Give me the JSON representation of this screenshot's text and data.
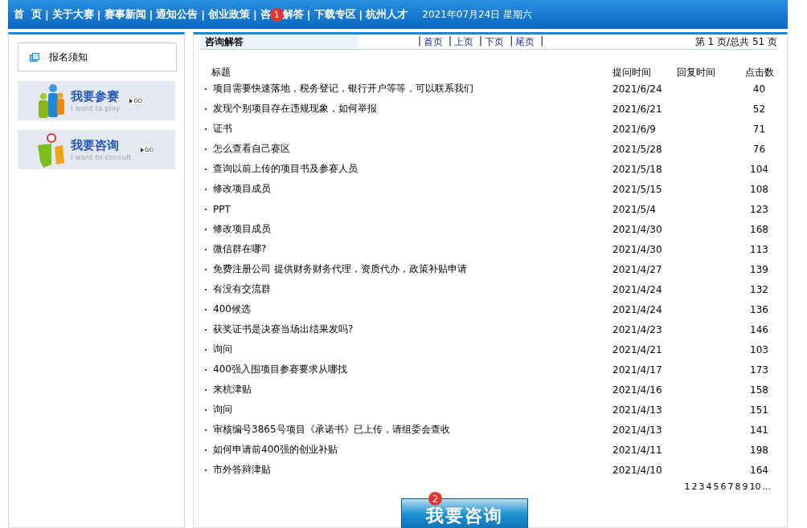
{
  "nav": {
    "separator": "|",
    "items": [
      {
        "label": "首  页"
      },
      {
        "label": "关于大赛"
      },
      {
        "label": "赛事新闻"
      },
      {
        "label": "通知公告"
      },
      {
        "label": "创业政策"
      },
      {
        "label": "咨",
        "label_after": "解答",
        "badge": "1"
      },
      {
        "label": "下载专区"
      },
      {
        "label": "杭州人才"
      }
    ],
    "date": "2021年07月24日 星期六"
  },
  "sidebar": {
    "notice": "报名须知",
    "banners": [
      {
        "kind": "play",
        "title": "我要参赛",
        "subtitle": "I want to play",
        "go": "GO"
      },
      {
        "kind": "consult",
        "title": "我要咨询",
        "subtitle": "I want to consult",
        "go": "GO"
      }
    ]
  },
  "panel": {
    "title": "咨询解答",
    "separator": "|",
    "pager_links": [
      "首页",
      "上页",
      "下页",
      "尾页"
    ],
    "page_info": "第 1 页/总共 51 页"
  },
  "table": {
    "columns": [
      "标题",
      "提问时间",
      "回复时间",
      "点击数"
    ],
    "rows": [
      {
        "title": "项目需要快速落地，税务登记，银行开户等等，可以联系我们",
        "asked": "2021/6/24",
        "clicks": "40"
      },
      {
        "title": "发现个别项目存在违规现象，如何举报",
        "asked": "2021/6/21",
        "clicks": "52"
      },
      {
        "title": "证书",
        "asked": "2021/6/9",
        "clicks": "71"
      },
      {
        "title": "怎么查看自己赛区",
        "asked": "2021/5/28",
        "clicks": "76"
      },
      {
        "title": "查询以前上传的项目书及参赛人员",
        "asked": "2021/5/18",
        "clicks": "104"
      },
      {
        "title": "修改项目成员",
        "asked": "2021/5/15",
        "clicks": "108"
      },
      {
        "title": "PPT",
        "asked": "2021/5/4",
        "clicks": "123"
      },
      {
        "title": "修改项目成员",
        "asked": "2021/4/30",
        "clicks": "168"
      },
      {
        "title": "微信群在哪?",
        "asked": "2021/4/30",
        "clicks": "113"
      },
      {
        "title": "免费注册公司 提供财务财务代理，资质代办，政策补贴申请",
        "asked": "2021/4/27",
        "clicks": "139"
      },
      {
        "title": "有没有交流群",
        "asked": "2021/4/24",
        "clicks": "132"
      },
      {
        "title": "400候选",
        "asked": "2021/4/24",
        "clicks": "136"
      },
      {
        "title": "获奖证书是决赛当场出结果发吗?",
        "asked": "2021/4/23",
        "clicks": "146"
      },
      {
        "title": "询问",
        "asked": "2021/4/21",
        "clicks": "103"
      },
      {
        "title": "400强入围项目参赛要求从哪找",
        "asked": "2021/4/17",
        "clicks": "173"
      },
      {
        "title": "来杭津贴",
        "asked": "2021/4/16",
        "clicks": "158"
      },
      {
        "title": "询问",
        "asked": "2021/4/13",
        "clicks": "151"
      },
      {
        "title": "审核编号3865号项目《承诺书》已上传，请组委会查收",
        "asked": "2021/4/13",
        "clicks": "141"
      },
      {
        "title": "如何申请前400强的创业补贴",
        "asked": "2021/4/11",
        "clicks": "198"
      },
      {
        "title": "市外答辩津贴",
        "asked": "2021/4/10",
        "clicks": "164"
      }
    ]
  },
  "pages": [
    "1",
    "2",
    "3",
    "4",
    "5",
    "6",
    "7",
    "8",
    "9",
    "10",
    "..."
  ],
  "consult_button": {
    "label": "我要咨询",
    "badge": "2"
  }
}
